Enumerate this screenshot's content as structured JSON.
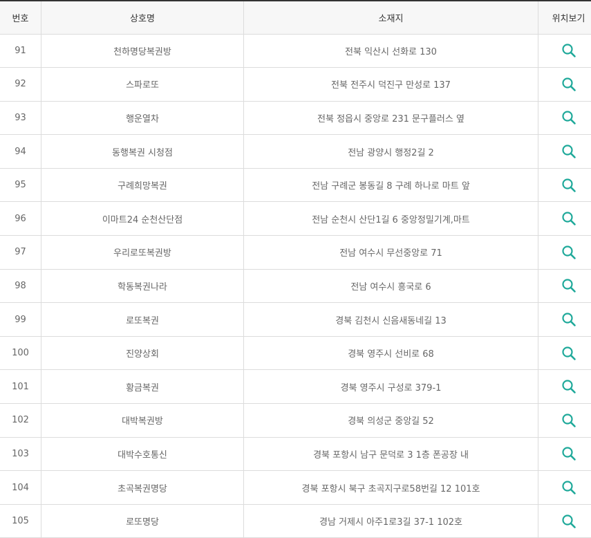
{
  "table": {
    "headers": [
      "번호",
      "상호명",
      "소재지",
      "위치보기"
    ],
    "rows": [
      {
        "no": "91",
        "name": "천하명당복권방",
        "address": "전북 익산시 선화로 130",
        "icon": "search-icon"
      },
      {
        "no": "92",
        "name": "스파로또",
        "address": "전북 전주시 덕진구 만성로 137",
        "icon": "search-icon"
      },
      {
        "no": "93",
        "name": "행운열차",
        "address": "전북 정읍시 중앙로 231 문구플러스 옆",
        "icon": "search-icon"
      },
      {
        "no": "94",
        "name": "동행복권 시청점",
        "address": "전남 광양시 행정2길 2",
        "icon": "search-icon"
      },
      {
        "no": "95",
        "name": "구례희망복권",
        "address": "전남 구례군 봉동길 8 구례 하나로 마트 앞",
        "icon": "search-icon"
      },
      {
        "no": "96",
        "name": "이마트24 순천산단점",
        "address": "전남 순천시 산단1길 6 중앙정밀기계,마트",
        "icon": "search-icon"
      },
      {
        "no": "97",
        "name": "우리로또복권방",
        "address": "전남 여수시 무선중앙로 71",
        "icon": "search-icon"
      },
      {
        "no": "98",
        "name": "학동복권나라",
        "address": "전남 여수시 흥국로 6",
        "icon": "search-icon"
      },
      {
        "no": "99",
        "name": "로또복권",
        "address": "경북 김천시 신음새동네길 13",
        "icon": "search-icon"
      },
      {
        "no": "100",
        "name": "진양상회",
        "address": "경북 영주시 선비로 68",
        "icon": "search-icon"
      },
      {
        "no": "101",
        "name": "황금복권",
        "address": "경북 영주시 구성로 379-1",
        "icon": "search-icon"
      },
      {
        "no": "102",
        "name": "대박복권방",
        "address": "경북 의성군 중앙길 52",
        "icon": "search-icon"
      },
      {
        "no": "103",
        "name": "대박수호통신",
        "address": "경북 포항시 남구 문덕로 3 1층 폰공장 내",
        "icon": "search-icon"
      },
      {
        "no": "104",
        "name": "초곡복권명당",
        "address": "경북 포항시 북구 초곡지구로58번길 12 101호",
        "icon": "search-icon"
      },
      {
        "no": "105",
        "name": "로또명당",
        "address": "경남 거제시 아주1로3길 37-1 102호",
        "icon": "search-icon"
      }
    ]
  },
  "colors": {
    "accent": "#1fa99a",
    "header_bg": "#f7f7f7",
    "border": "#dcdcdc",
    "text": "#666666"
  }
}
